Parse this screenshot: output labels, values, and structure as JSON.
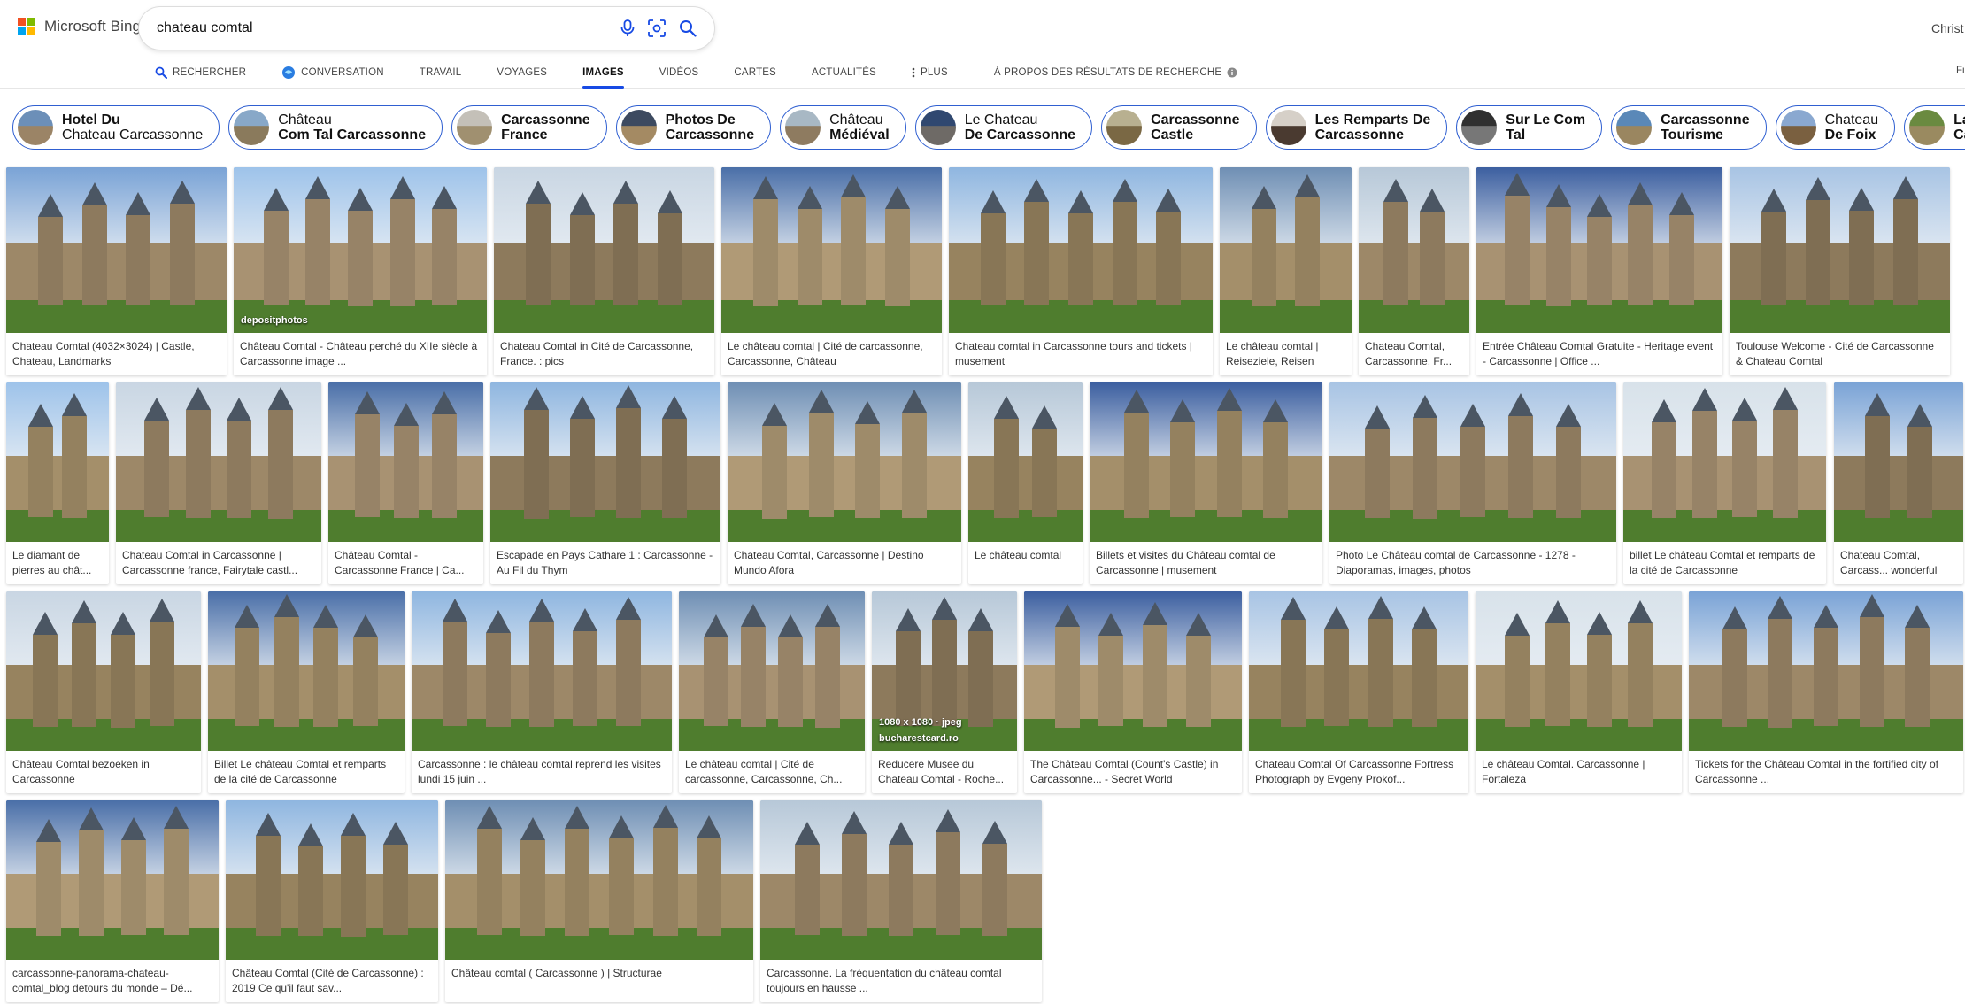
{
  "brand": {
    "name": "Microsoft Bing",
    "colors": [
      "#f25022",
      "#7fba00",
      "#00a4ef",
      "#ffb900"
    ]
  },
  "search": {
    "value": "chateau comtal"
  },
  "user": {
    "name": "Christ"
  },
  "nav": {
    "tabs": [
      {
        "label": "RECHERCHER",
        "icon": "search-icon",
        "active": false
      },
      {
        "label": "CONVERSATION",
        "icon": "copilot-icon",
        "active": false
      },
      {
        "label": "TRAVAIL",
        "icon": "",
        "active": false
      },
      {
        "label": "VOYAGES",
        "icon": "",
        "active": false
      },
      {
        "label": "IMAGES",
        "icon": "",
        "active": true
      },
      {
        "label": "VIDÉOS",
        "icon": "",
        "active": false
      },
      {
        "label": "CARTES",
        "icon": "",
        "active": false
      },
      {
        "label": "ACTUALITÉS",
        "icon": "",
        "active": false
      },
      {
        "label": "PLUS",
        "icon": "more-vertical-icon",
        "active": false
      },
      {
        "label": "À PROPOS DES RÉSULTATS DE RECHERCHE",
        "icon": "info-icon",
        "active": false
      }
    ],
    "right_label": "Fi",
    "accent": "#174ae4"
  },
  "chips": [
    {
      "line1": "Hotel Du",
      "line2": "Chateau Carcassonne",
      "bold_line": 1
    },
    {
      "line1": "Château",
      "line2": "Com Tal Carcassonne",
      "bold_line": 2
    },
    {
      "line1": "Carcassonne",
      "line2": "France",
      "bold_line": 0
    },
    {
      "line1": "Photos De",
      "line2": "Carcassonne",
      "bold_line": 0
    },
    {
      "line1": "Château",
      "line2": "Médiéval",
      "bold_line": 2
    },
    {
      "line1": "Le Chateau",
      "line2": "De Carcassonne",
      "bold_line": 2
    },
    {
      "line1": "Carcassonne",
      "line2": "Castle",
      "bold_line": 0
    },
    {
      "line1": "Les Remparts De",
      "line2": "Carcassonne",
      "bold_line": 0
    },
    {
      "line1": "Sur Le Com",
      "line2": "Tal",
      "bold_line": 0
    },
    {
      "line1": "Carcassonne",
      "line2": "Tourisme",
      "bold_line": 0
    },
    {
      "line1": "Chateau",
      "line2": "De Foix",
      "bold_line": 2
    },
    {
      "line1": "La Cité De",
      "line2": "Carcassonne",
      "bold_line": 0
    }
  ],
  "results": [
    [
      {
        "caption": "Chateau Comtal (4032×3024) | Castle, Chateau, Landmarks"
      },
      {
        "caption": "Château Comtal - Château perché du XIIe siècle à Carcassonne image ...",
        "badge": "depositphotos"
      },
      {
        "caption": "Chateau Comtal in Cité de Carcassonne, France. : pics"
      },
      {
        "caption": "Le château comtal | Cité de carcassonne, Carcassonne, Château"
      },
      {
        "caption": "Chateau comtal in Carcassonne tours and tickets | musement"
      },
      {
        "caption": "Le château comtal | Reiseziele, Reisen"
      },
      {
        "caption": "Chateau Comtal, Carcassonne, Fr..."
      },
      {
        "caption": "Entrée Château Comtal Gratuite - Heritage event - Carcassonne | Office ..."
      },
      {
        "caption": "Toulouse Welcome - Cité de Carcassonne & Chateau Comtal"
      }
    ],
    [
      {
        "caption": "Le diamant de pierres au chât..."
      },
      {
        "caption": "Chateau Comtal in Carcassonne | Carcassonne france, Fairytale castl..."
      },
      {
        "caption": "Château Comtal - Carcassonne France | Ca..."
      },
      {
        "caption": "Escapade en Pays Cathare 1 : Carcassonne - Au Fil du Thym"
      },
      {
        "caption": "Chateau Comtal, Carcassonne | Destino Mundo Afora"
      },
      {
        "caption": "Le château comtal"
      },
      {
        "caption": "Billets et visites du Château comtal de Carcassonne | musement"
      },
      {
        "caption": "Photo Le Château comtal de Carcassonne - 1278 - Diaporamas, images, photos"
      },
      {
        "caption": "billet Le château Comtal et remparts de la cité de Carcassonne"
      },
      {
        "caption": "Chateau Comtal, Carcass... wonderful cities around th..."
      }
    ],
    [
      {
        "caption": "Château Comtal bezoeken in Carcassonne"
      },
      {
        "caption": "Billet Le château Comtal et remparts de la cité de Carcassonne"
      },
      {
        "caption": "Carcassonne : le château comtal reprend les visites lundi 15 juin ..."
      },
      {
        "caption": "Le château comtal | Cité de carcassonne, Carcassonne, Ch..."
      },
      {
        "caption": "Reducere Musee du Chateau Comtal - Roche...",
        "badge": "1080 x 1080 · jpeg",
        "badge2": "bucharestcard.ro"
      },
      {
        "caption": "The Château Comtal (Count's Castle) in Carcassonne... - Secret World"
      },
      {
        "caption": "Chateau Comtal Of Carcassonne Fortress Photograph by Evgeny Prokof..."
      },
      {
        "caption": "Le château Comtal. Carcassonne | Fortaleza"
      },
      {
        "caption": "Tickets for the Château Comtal in the fortified city of Carcassonne ..."
      }
    ],
    [
      {
        "caption": "carcassonne-panorama-chateau-comtal_blog detours du monde – Dé..."
      },
      {
        "caption": "Château Comtal (Cité de Carcassonne) : 2019 Ce qu'il faut sav..."
      },
      {
        "caption": "Château comtal ( Carcassonne ) | Structurae"
      },
      {
        "caption": "Carcassonne. La fréquentation du château comtal toujours en hausse ..."
      }
    ]
  ]
}
